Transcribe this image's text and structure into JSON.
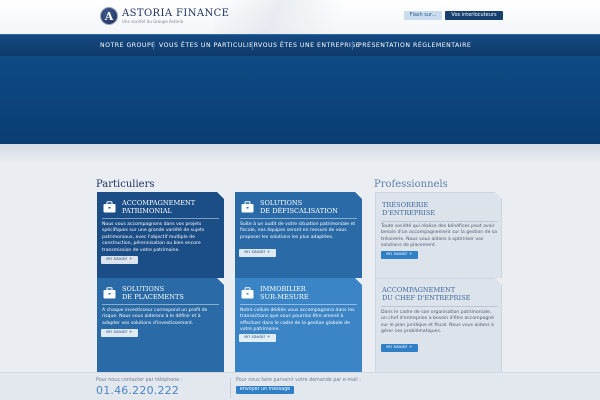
{
  "header": {
    "logo_letter": "A",
    "logo_name": "ASTORIA FINANCE",
    "logo_tagline": "Une société du Groupe Astoria",
    "flash_button": "Flash sur...",
    "contacts_button": "Vos interlocuteurs"
  },
  "nav": {
    "items": [
      {
        "label": "NOTRE GROUPE"
      },
      {
        "label": "VOUS ÊTES UN PARTICULIER"
      },
      {
        "label": "VOUS ÊTES UNE ENTREPRISE"
      },
      {
        "label": "PRÉSENTATION RÉGLEMENTAIRE"
      }
    ]
  },
  "particuliers": {
    "title": "Particuliers",
    "cards": [
      {
        "icon": "briefcase-icon",
        "color": "#1b4d87",
        "title": "ACCOMPAGNEMENT\nPATRIMONIAL",
        "text": "Nous vous accompagnons dans vos projets spécifiques sur une grande variété de sujets patrimoniaux, avec l'objectif multiple de construction, pérennisation ou bien encore transmission de votre patrimoine.",
        "button": "en savoir +"
      },
      {
        "icon": "briefcase-icon",
        "color": "#2a6aa6",
        "title": "SOLUTIONS\nDE DÉFISCALISATION",
        "text": "Suite à un audit de votre situation patrimoniale et fiscale, nos équipes seront en mesure de vous proposer les solutions les plus adaptées.",
        "button": "en savoir +"
      },
      {
        "icon": "briefcase-icon",
        "color": "#2a6aa6",
        "title": "SOLUTIONS\nDE PLACEMENTS",
        "text": "A chaque investisseur correspond un profil de risque. Nous vous aiderons à le définir et à adapter vos solutions d'investissement.",
        "button": "en savoir +"
      },
      {
        "icon": "briefcase-icon",
        "color": "#3b84c5",
        "title": "IMMOBILIER\nSUR-MESURE",
        "text": "Notre cellule dédiée vous accompagnera dans les transactions que vous pourriez être amené à effectuer dans le cadre de la gestion globale de votre patrimoine.",
        "button": "en savoir +"
      }
    ]
  },
  "professionnels": {
    "title": "Professionnels",
    "cards": [
      {
        "title": "TRÉSORERIE\nD'ENTREPRISE",
        "text": "Toute société qui réalise des bénéfices peut avoir besoin d'un accompagnement sur la gestion de sa trésorerie. Nous vous aidons à optimiser vos solutions de placement.",
        "button": "en savoir +"
      },
      {
        "title": "ACCOMPAGNEMENT\nDU CHEF D'ENTREPRISE",
        "text": "Dans le cadre de son organisation patrimoniale, un chef d'entreprise a besoin d'être accompagné sur le plan juridique et fiscal. Nous vous aidons à gérer ces problématiques.",
        "button": "en savoir +"
      }
    ]
  },
  "footer": {
    "phone_label": "Pour nous contacter par téléphone :",
    "phone": "01.46.220.222",
    "mail_label": "Pour nous faire parvenir votre demande par e-mail :",
    "mail_button": "envoyer un message"
  }
}
